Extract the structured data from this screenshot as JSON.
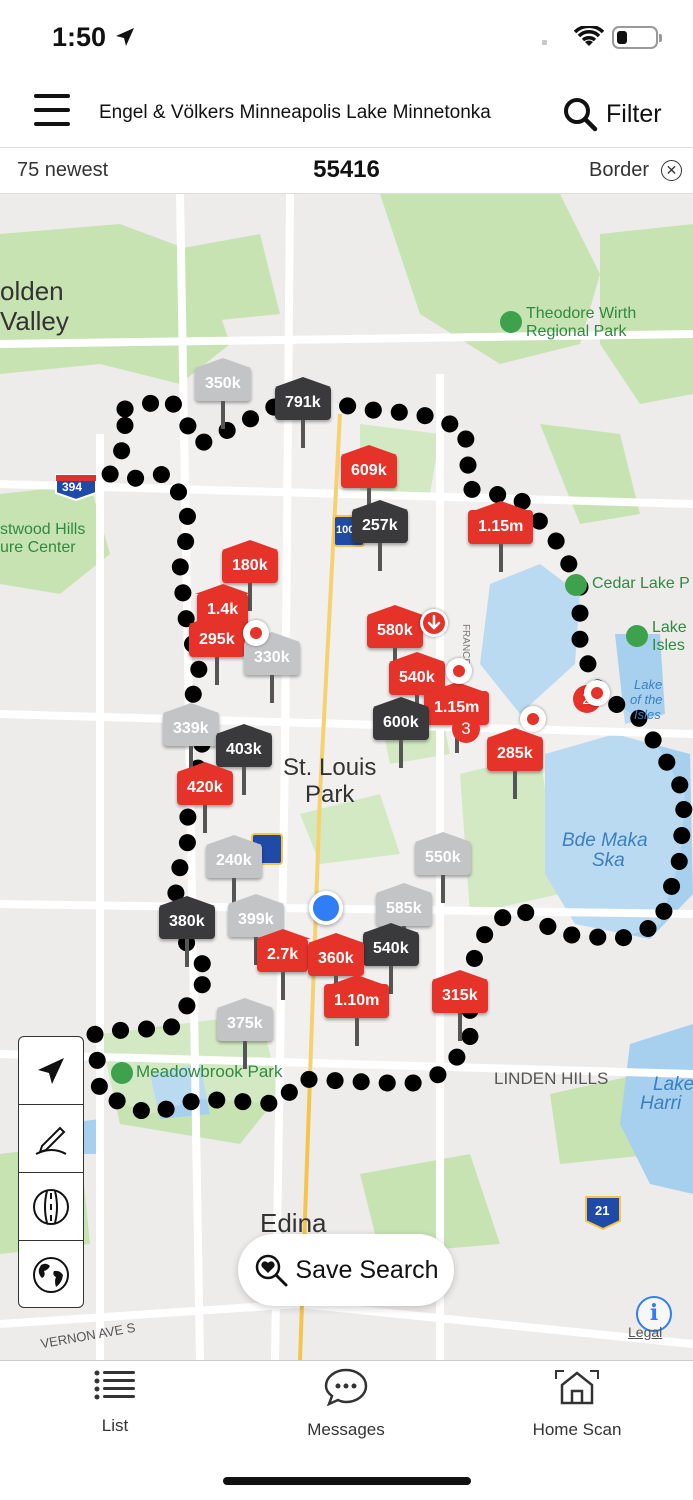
{
  "status_bar": {
    "time": "1:50"
  },
  "header": {
    "title": "Engel & Völkers Minneapolis Lake Minnetonka",
    "filter_label": "Filter"
  },
  "subbar": {
    "newest": "75 newest",
    "zip": "55416",
    "border_label": "Border"
  },
  "map": {
    "places": {
      "golden": "olden",
      "valley": "Valley",
      "theodore": "Theodore Wirth",
      "regional": "Regional Park",
      "westwood": "stwood Hills",
      "center": "ure Center",
      "cedar": "Cedar Lake P",
      "lake_isles_1": "Lake",
      "lake_isles_2": "Isles",
      "lake_of_1": "Lake",
      "lake_of_2": "of the",
      "lake_of_3": "Isles",
      "stlouis_1": "St. Louis",
      "stlouis_2": "Park",
      "bde_1": "Bde Maka",
      "bde_2": "Ska",
      "meadowbrook": "Meadowbrook Park",
      "linden": "LINDEN HILLS",
      "harriet_1": "Lake",
      "harriet_2": "Harri",
      "edina": "Edina",
      "vernon": "VERNON AVE S",
      "france": "FRANCE",
      "hw394": "394",
      "hw100": "100",
      "hw21": "21"
    },
    "pins": [
      {
        "label": "350k",
        "color": "light"
      },
      {
        "label": "791k",
        "color": "dark"
      },
      {
        "label": "609k",
        "color": "red"
      },
      {
        "label": "257k",
        "color": "dark"
      },
      {
        "label": "1.15m",
        "color": "red"
      },
      {
        "label": "180k",
        "color": "red"
      },
      {
        "label": "1.4k",
        "color": "red"
      },
      {
        "label": "295k",
        "color": "red"
      },
      {
        "label": "330k",
        "color": "light"
      },
      {
        "label": "580k",
        "color": "red"
      },
      {
        "label": "540k",
        "color": "red"
      },
      {
        "label": "1.15m",
        "color": "red"
      },
      {
        "label": "600k",
        "color": "dark"
      },
      {
        "label": "285k",
        "color": "red"
      },
      {
        "label": "339k",
        "color": "light"
      },
      {
        "label": "403k",
        "color": "dark"
      },
      {
        "label": "420k",
        "color": "red"
      },
      {
        "label": "240k",
        "color": "light"
      },
      {
        "label": "550k",
        "color": "light"
      },
      {
        "label": "585k",
        "color": "light"
      },
      {
        "label": "380k",
        "color": "dark"
      },
      {
        "label": "399k",
        "color": "light"
      },
      {
        "label": "540k",
        "color": "dark"
      },
      {
        "label": "2.7k",
        "color": "red"
      },
      {
        "label": "360k",
        "color": "red"
      },
      {
        "label": "1.10m",
        "color": "red"
      },
      {
        "label": "315k",
        "color": "red"
      },
      {
        "label": "375k",
        "color": "light"
      }
    ],
    "badges": [
      "3",
      "2"
    ]
  },
  "save_search_label": "Save Search",
  "legal_label": "Legal",
  "tabs": {
    "list": "List",
    "messages": "Messages",
    "home_scan": "Home Scan"
  }
}
